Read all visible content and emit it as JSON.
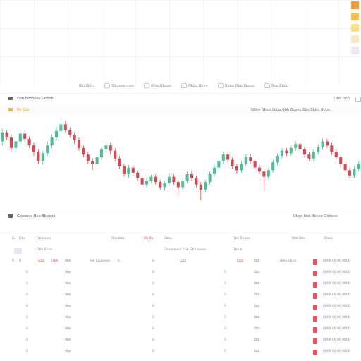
{
  "toolbar": {
    "tabs": [
      {
        "label": "Bbi Bbbo",
        "icon": "chart-icon"
      },
      {
        "label": "Gboooonooo",
        "icon": "layers-icon"
      },
      {
        "label": "Gbio Bbooo",
        "icon": "list-icon"
      },
      {
        "label": "Gbbe Bbno",
        "icon": "clock-icon"
      },
      {
        "label": "Gbbo Dbb Bbooo",
        "icon": "grid-icon"
      },
      {
        "label": "Boo Bbbo",
        "icon": "star-icon"
      }
    ]
  },
  "chart_panel": {
    "title": "Dob Bbooooo Gbbob",
    "right_action": "Dbo Gbo",
    "legend": "Bb Bbb",
    "info_line": "Gbbo Gbbo 0bbo Gbb Bbooo Bbo Bbbo Gbbo"
  },
  "table_panel": {
    "title": "Gbooooo Bbb Bbbooo",
    "right_text": "Dbgo bbb Bbooo Gbbobo",
    "header": [
      "Go",
      "Gbo",
      "Gbooooo",
      "Bbo bbo",
      "Bb Bb",
      "Gbbo",
      "Gbb Bbooo",
      "Bbb Bbo",
      "Bbbo"
    ],
    "subheader": [
      "Gbb Bbbo",
      "Gbooooooo bbb Gbbooooo",
      "Gbo b"
    ],
    "first_row": [
      "0",
      "0",
      "Gbb",
      "Gbb",
      "0bb",
      "Gb Gbooooo",
      "b",
      "0",
      "Gbb",
      "Gbb",
      "0bb",
      "Gbbo Gbbo",
      "0000 00 00 0000"
    ],
    "rows": [
      {
        "a": "0",
        "b": "0bb",
        "c": "0",
        "d": "0",
        "e": "0bb",
        "time": "0000 00 00 0000"
      },
      {
        "a": "0",
        "b": "0bb",
        "c": "0",
        "d": "0",
        "e": "0bb",
        "time": "0000 00 00 0000"
      },
      {
        "a": "0",
        "b": "0bb",
        "c": "0",
        "d": "0",
        "e": "0bb",
        "time": "0000 00 00 0000"
      },
      {
        "a": "0",
        "b": "0bb",
        "c": "0",
        "d": "0",
        "e": "0bb",
        "time": "0000 00 00 0000"
      },
      {
        "a": "0",
        "b": "0bb",
        "c": "0",
        "d": "0",
        "e": "0bb",
        "time": "0000 00 00 0000"
      },
      {
        "a": "0",
        "b": "0bb",
        "c": "0",
        "d": "0",
        "e": "0bb",
        "time": "0000 00 00 0000"
      },
      {
        "a": "0",
        "b": "0bb",
        "c": "0",
        "d": "0",
        "e": "0bb",
        "time": "0000 00 00 0000"
      },
      {
        "a": "0",
        "b": "0bb",
        "c": "0",
        "d": "0",
        "e": "0bb",
        "time": "0000 00 00 0000"
      }
    ]
  },
  "swatches": [
    "#f39c3d",
    "#f7c35a",
    "#f9dd8b",
    "#fbe6c4",
    "#efe6f4"
  ],
  "candles": [
    [
      55,
      62,
      52,
      65
    ],
    [
      62,
      58,
      56,
      64
    ],
    [
      58,
      50,
      48,
      60
    ],
    [
      50,
      55,
      47,
      57
    ],
    [
      55,
      61,
      53,
      63
    ],
    [
      61,
      57,
      55,
      63
    ],
    [
      57,
      52,
      50,
      59
    ],
    [
      52,
      47,
      44,
      54
    ],
    [
      47,
      40,
      38,
      49
    ],
    [
      40,
      46,
      37,
      48
    ],
    [
      46,
      52,
      44,
      55
    ],
    [
      52,
      58,
      50,
      60
    ],
    [
      58,
      63,
      56,
      66
    ],
    [
      63,
      68,
      61,
      70
    ],
    [
      68,
      64,
      62,
      71
    ],
    [
      64,
      60,
      58,
      66
    ],
    [
      60,
      56,
      53,
      62
    ],
    [
      56,
      50,
      48,
      58
    ],
    [
      50,
      45,
      43,
      52
    ],
    [
      45,
      40,
      38,
      47
    ],
    [
      40,
      38,
      33,
      42
    ],
    [
      38,
      43,
      36,
      45
    ],
    [
      43,
      49,
      41,
      51
    ],
    [
      49,
      52,
      47,
      55
    ],
    [
      52,
      48,
      45,
      54
    ],
    [
      48,
      42,
      40,
      50
    ],
    [
      42,
      36,
      34,
      44
    ],
    [
      36,
      30,
      28,
      38
    ],
    [
      30,
      35,
      27,
      37
    ],
    [
      35,
      31,
      29,
      37
    ],
    [
      31,
      27,
      25,
      33
    ],
    [
      27,
      22,
      18,
      29
    ],
    [
      22,
      25,
      20,
      27
    ],
    [
      25,
      28,
      23,
      30
    ],
    [
      28,
      24,
      22,
      30
    ],
    [
      24,
      20,
      18,
      26
    ],
    [
      20,
      23,
      17,
      25
    ],
    [
      23,
      28,
      21,
      30
    ],
    [
      28,
      24,
      22,
      30
    ],
    [
      24,
      20,
      15,
      26
    ],
    [
      20,
      25,
      18,
      27
    ],
    [
      25,
      30,
      23,
      32
    ],
    [
      30,
      27,
      25,
      33
    ],
    [
      27,
      22,
      20,
      29
    ],
    [
      22,
      18,
      10,
      24
    ],
    [
      18,
      24,
      16,
      26
    ],
    [
      24,
      30,
      22,
      32
    ],
    [
      30,
      35,
      28,
      37
    ],
    [
      35,
      40,
      33,
      42
    ],
    [
      40,
      45,
      38,
      47
    ],
    [
      45,
      41,
      39,
      47
    ],
    [
      41,
      36,
      34,
      43
    ],
    [
      36,
      33,
      30,
      38
    ],
    [
      33,
      38,
      31,
      40
    ],
    [
      38,
      43,
      36,
      45
    ],
    [
      43,
      40,
      38,
      45
    ],
    [
      40,
      35,
      33,
      42
    ],
    [
      35,
      32,
      30,
      37
    ],
    [
      32,
      28,
      18,
      34
    ],
    [
      28,
      33,
      26,
      35
    ],
    [
      33,
      39,
      31,
      41
    ],
    [
      39,
      44,
      37,
      46
    ],
    [
      44,
      48,
      42,
      50
    ],
    [
      48,
      46,
      44,
      50
    ],
    [
      46,
      50,
      44,
      52
    ],
    [
      50,
      53,
      48,
      55
    ],
    [
      53,
      49,
      47,
      55
    ],
    [
      49,
      45,
      43,
      51
    ],
    [
      45,
      42,
      40,
      47
    ],
    [
      42,
      47,
      40,
      49
    ],
    [
      47,
      51,
      45,
      53
    ],
    [
      51,
      55,
      49,
      57
    ],
    [
      55,
      52,
      50,
      57
    ],
    [
      52,
      47,
      45,
      54
    ],
    [
      47,
      43,
      41,
      49
    ],
    [
      43,
      38,
      35,
      45
    ],
    [
      38,
      33,
      31,
      40
    ],
    [
      33,
      29,
      27,
      35
    ],
    [
      29,
      34,
      27,
      36
    ],
    [
      34,
      38,
      32,
      40
    ]
  ]
}
